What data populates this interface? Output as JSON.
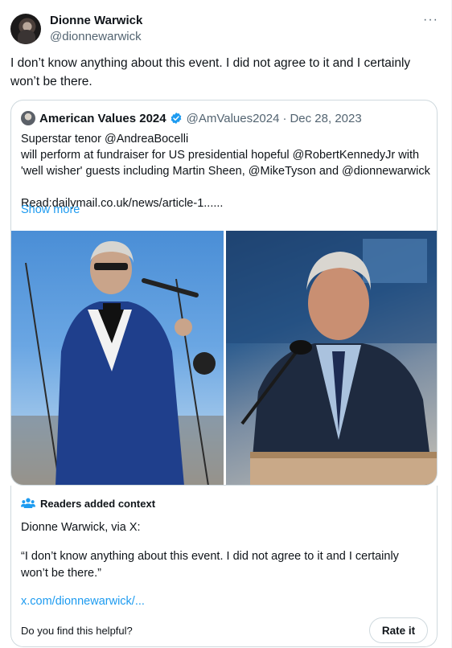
{
  "tweet": {
    "author_name": "Dionne Warwick",
    "author_handle": "@dionnewarwick",
    "more_icon": "···",
    "text": "I don’t know anything about this event. I did not agree to it and I certainly won’t be there."
  },
  "quoted_tweet": {
    "author_name": "American Values 2024",
    "author_handle": "@AmValues2024",
    "separator": "·",
    "date": "Dec 28, 2023",
    "verified_color": "#1d9bf0",
    "lines": [
      "Superstar tenor @AndreaBocelli",
      "will perform at fundraiser for US presidential hopeful @RobertKennedyJr with",
      "'well wisher' guests including Martin Sheen, @MikeTyson and @dionnewarwick",
      "",
      "Read:dailymail.co.uk/news/article-1......"
    ],
    "show_more": "Show more",
    "media": [
      {
        "description_icon": "photo-singer-icon"
      },
      {
        "description_icon": "photo-speaker-icon"
      }
    ]
  },
  "community_note": {
    "title": "Readers added context",
    "source_line": "Dionne Warwick, via X:",
    "quote": "“I don’t know anything about this event. I did not agree to it and I certainly won’t be there.”",
    "link": "x.com/dionnewarwick/...",
    "helpful_prompt": "Do you find this helpful?",
    "rate_button": "Rate it",
    "accent_color": "#1d9bf0"
  }
}
